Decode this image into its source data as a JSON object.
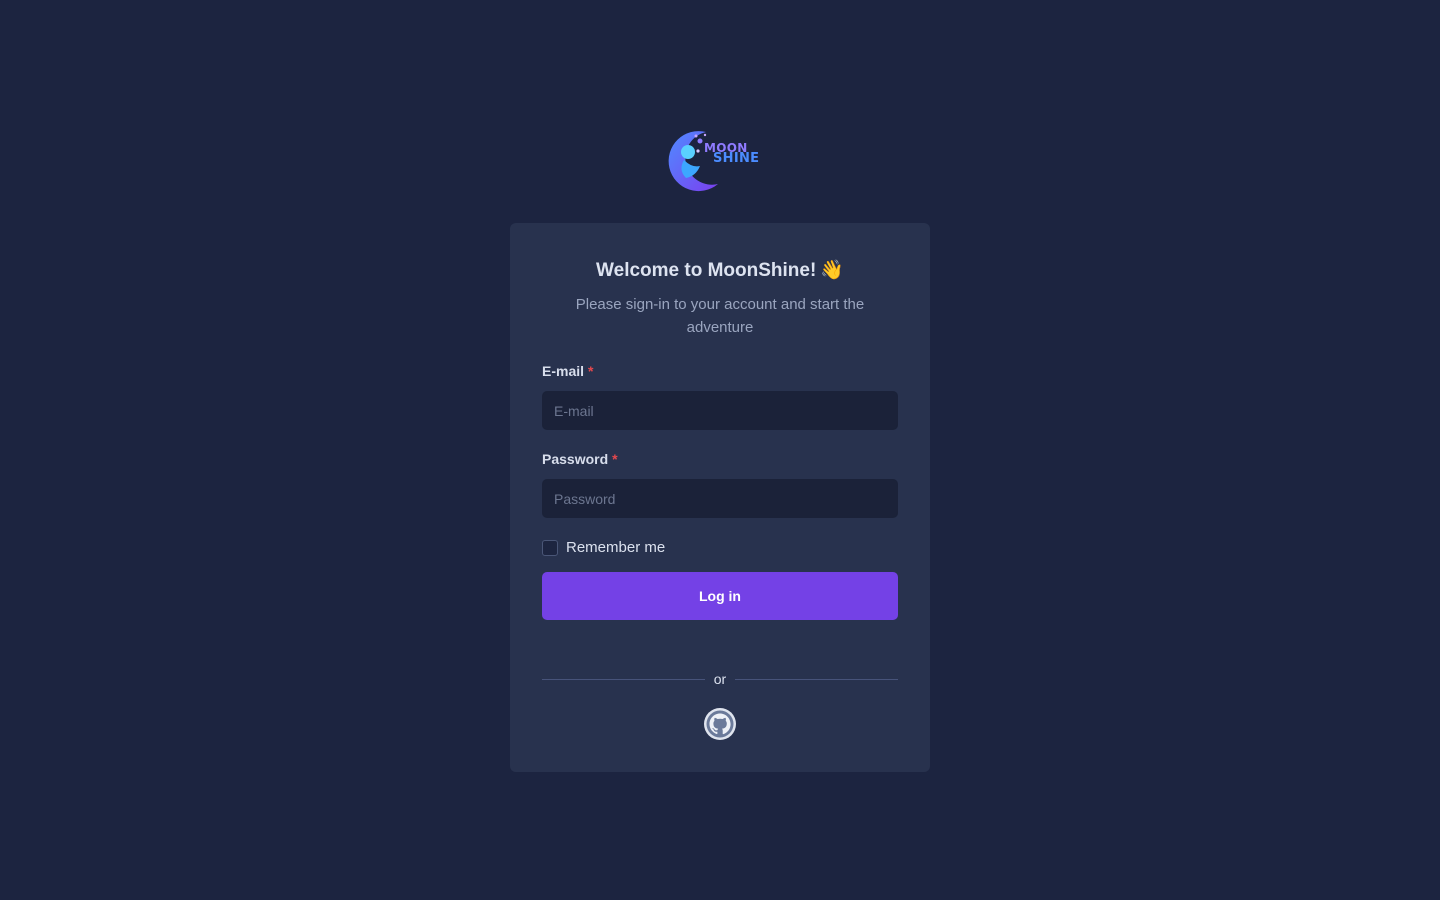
{
  "brand": {
    "logo_line1": "MOON",
    "logo_line2": "SHINE"
  },
  "card": {
    "title": "Welcome to MoonShine!",
    "title_emoji": "👋",
    "subtitle": "Please sign-in to your account and start the adventure"
  },
  "form": {
    "email_label": "E-mail",
    "email_placeholder": "E-mail",
    "email_value": "",
    "password_label": "Password",
    "password_placeholder": "Password",
    "password_value": "",
    "required_mark": "*",
    "remember_label": "Remember me",
    "remember_checked": false,
    "submit_label": "Log in"
  },
  "social": {
    "divider_text": "or",
    "providers": [
      {
        "name": "github",
        "icon": "github-icon"
      }
    ]
  },
  "colors": {
    "background": "#1c2440",
    "card": "#28324e",
    "input": "#1b2239",
    "accent": "#7441e6",
    "required": "#e5484d"
  }
}
